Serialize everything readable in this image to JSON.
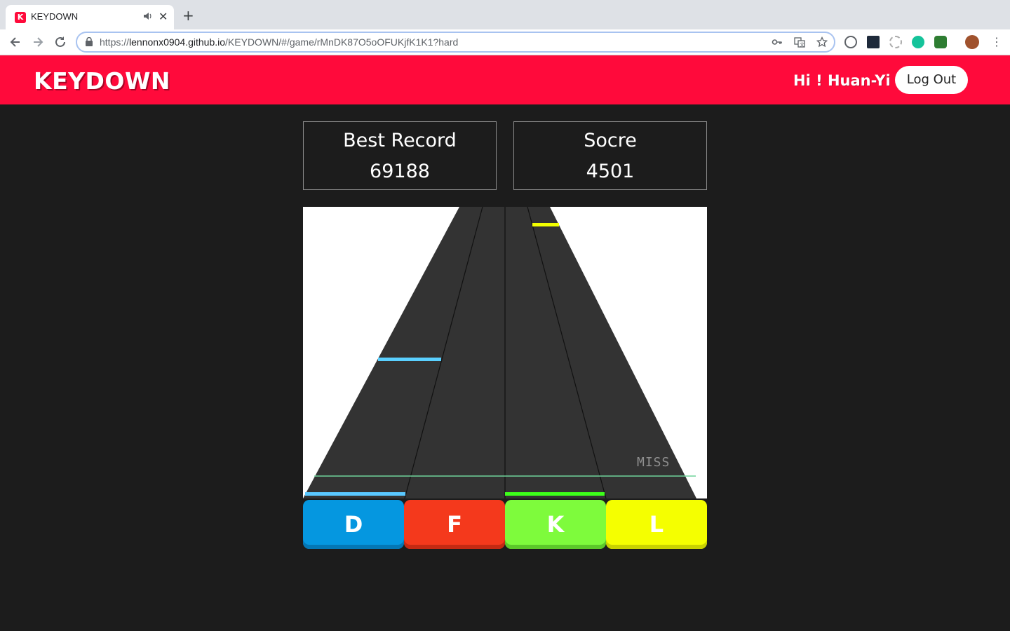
{
  "browser": {
    "tab_title": "KEYDOWN",
    "favicon_letter": "K",
    "url_prefix": "https://",
    "url_host": "lennonx0904.github.io",
    "url_path": "/KEYDOWN/#/game/rMnDK87O5oOFUKjfK1K1?hard"
  },
  "header": {
    "logo": "KEYDOWN",
    "greeting": "Hi ! Huan-Yi",
    "logout_label": "Log Out",
    "color": "#ff0a3b"
  },
  "scores": {
    "best_label": "Best Record",
    "best_value": "69188",
    "score_label": "Socre",
    "score_value": "4501"
  },
  "game": {
    "status_text": "MISS",
    "lanes": [
      {
        "key": "D",
        "color": "#0597e0"
      },
      {
        "key": "F",
        "color": "#f4391c"
      },
      {
        "key": "K",
        "color": "#7efb3c"
      },
      {
        "key": "L",
        "color": "#f5ff00"
      }
    ]
  }
}
